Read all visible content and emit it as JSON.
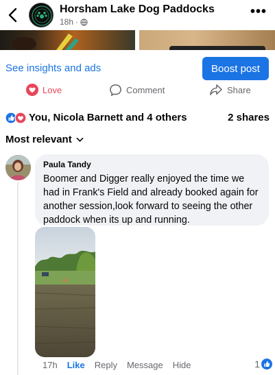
{
  "header": {
    "page_name": "Horsham Lake Dog Paddocks",
    "time": "18h",
    "separator": "·",
    "more": "•••"
  },
  "post": {
    "insights_link": "See insights and ads",
    "boost_button": "Boost post",
    "actions": {
      "love": "Love",
      "comment": "Comment",
      "share": "Share"
    },
    "reactions_summary": "You, Nicola Barnett and 4 others",
    "shares": "2 shares",
    "sort_label": "Most relevant"
  },
  "comment": {
    "author": "Paula Tandy",
    "text": "Boomer and Digger really enjoyed the time we had in Frank's Field and already booked again for another session,look forward to seeing the other paddock when its up and running.",
    "time": "17h",
    "like": "Like",
    "reply": "Reply",
    "message": "Message",
    "hide": "Hide",
    "like_count": "1"
  },
  "colors": {
    "accent": "#1b74e4",
    "love": "#e8465a",
    "secondary_text": "#65676b",
    "bubble": "#f0f2f5"
  },
  "icons": {
    "back": "chevron-left-icon",
    "globe": "globe-icon",
    "more": "more-dots-icon",
    "love": "heart-icon",
    "comment": "comment-bubble-icon",
    "share": "share-arrow-icon",
    "like_reaction": "thumbs-up-icon",
    "love_reaction": "heart-reaction-icon",
    "dropdown": "chevron-down-icon"
  }
}
